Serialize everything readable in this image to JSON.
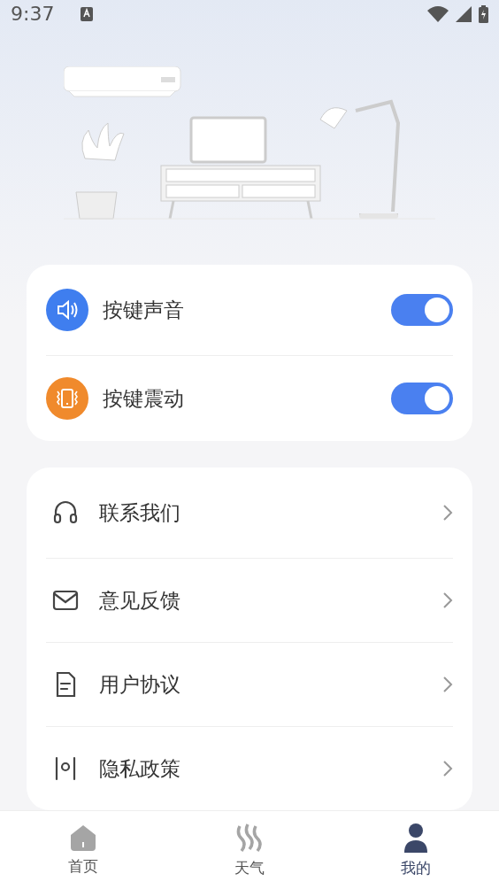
{
  "status_bar": {
    "time": "9:37"
  },
  "toggles": [
    {
      "kind": "sound",
      "label": "按键声音",
      "on": true
    },
    {
      "kind": "vibrate",
      "label": "按键震动",
      "on": true
    }
  ],
  "menu": [
    {
      "kind": "headset",
      "label": "联系我们"
    },
    {
      "kind": "mail",
      "label": "意见反馈"
    },
    {
      "kind": "doc",
      "label": "用户协议"
    },
    {
      "kind": "privacy",
      "label": "隐私政策"
    }
  ],
  "tabs": [
    {
      "kind": "home",
      "label": "首页",
      "selected": false
    },
    {
      "kind": "weather",
      "label": "天气",
      "selected": false
    },
    {
      "kind": "me",
      "label": "我的",
      "selected": true
    }
  ]
}
